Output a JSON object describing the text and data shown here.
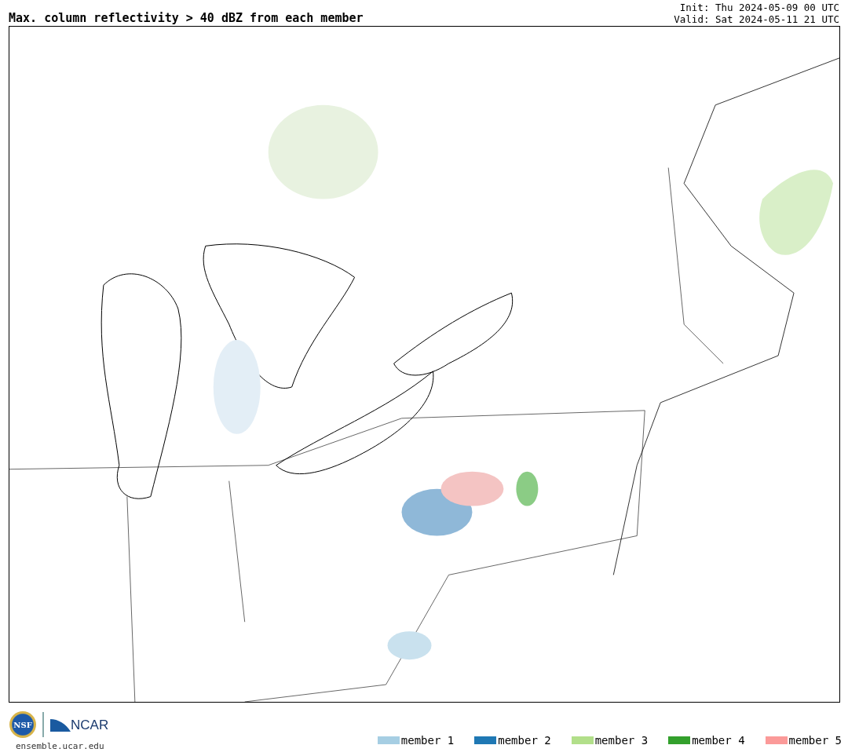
{
  "title": "Max. column reflectivity > 40 dBZ from each member",
  "run_info": [
    "Init: Thu 2024-05-09 00 UTC",
    "Valid: Sat 2024-05-11 21 UTC"
  ],
  "logos": {
    "nsf": "NSF",
    "ncar": "NCAR"
  },
  "footer_url": "ensemble.ucar.edu",
  "legend": [
    {
      "label": "member 1",
      "color": "#a6cee3"
    },
    {
      "label": "member 2",
      "color": "#1f78b4"
    },
    {
      "label": "member 3",
      "color": "#b2df8a"
    },
    {
      "label": "member 4",
      "color": "#33a02c"
    },
    {
      "label": "member 5",
      "color": "#fb9a99"
    }
  ]
}
